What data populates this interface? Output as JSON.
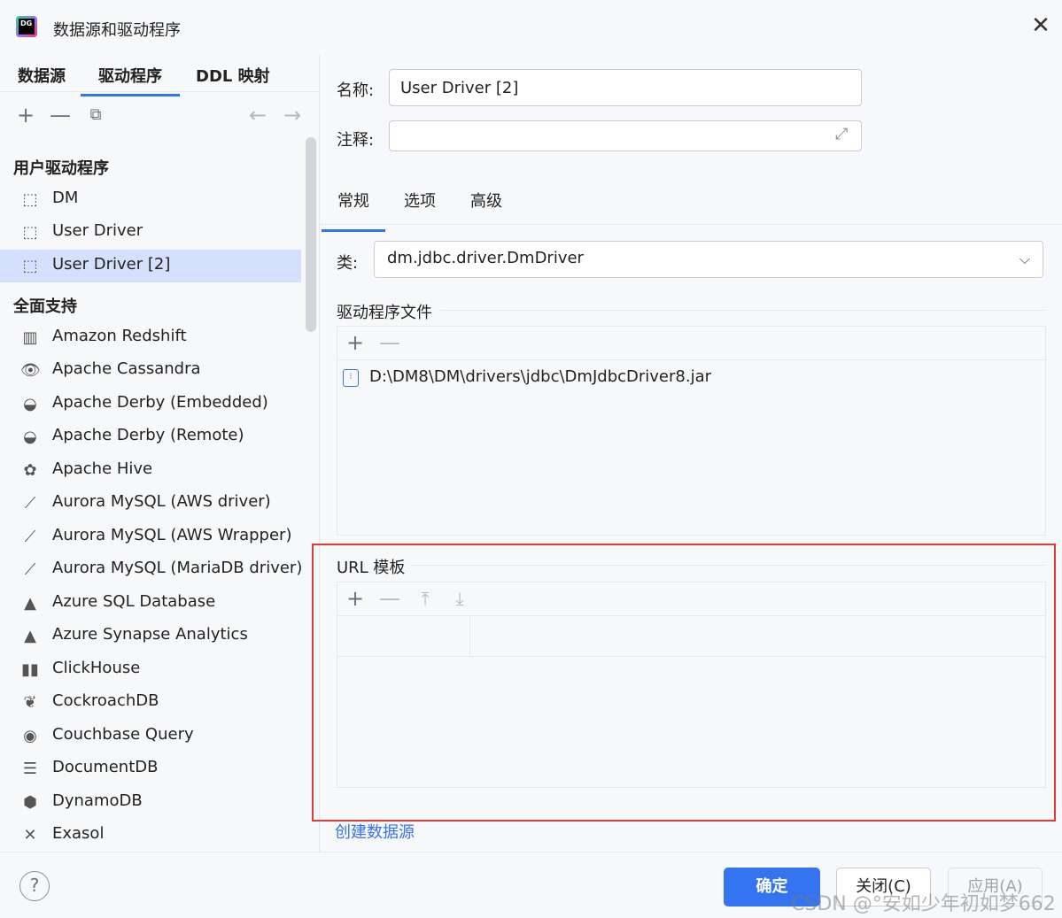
{
  "window": {
    "title": "数据源和驱动程序",
    "logo_text": "DG"
  },
  "left": {
    "tabs": [
      {
        "label": "数据源"
      },
      {
        "label": "驱动程序"
      },
      {
        "label": "DDL 映射"
      }
    ],
    "groups": [
      {
        "title": "用户驱动程序"
      },
      {
        "title": "全面支持"
      }
    ],
    "items": [
      {
        "label": "DM",
        "icon": "dashed-square-icon"
      },
      {
        "label": "User Driver",
        "icon": "dashed-square-icon"
      },
      {
        "label": "User Driver [2]",
        "icon": "dashed-square-icon"
      },
      {
        "label": "Amazon Redshift",
        "icon": "redshift-icon"
      },
      {
        "label": "Apache Cassandra",
        "icon": "cassandra-icon"
      },
      {
        "label": "Apache Derby (Embedded)",
        "icon": "derby-icon"
      },
      {
        "label": "Apache Derby (Remote)",
        "icon": "derby-icon"
      },
      {
        "label": "Apache Hive",
        "icon": "hive-icon"
      },
      {
        "label": "Aurora MySQL (AWS driver)",
        "icon": "mysql-icon"
      },
      {
        "label": "Aurora MySQL (AWS Wrapper)",
        "icon": "mysql-icon"
      },
      {
        "label": "Aurora MySQL (MariaDB driver)",
        "icon": "mysql-icon"
      },
      {
        "label": "Azure SQL Database",
        "icon": "azure-icon"
      },
      {
        "label": "Azure Synapse Analytics",
        "icon": "azure-icon"
      },
      {
        "label": "ClickHouse",
        "icon": "clickhouse-icon"
      },
      {
        "label": "CockroachDB",
        "icon": "cockroach-icon"
      },
      {
        "label": "Couchbase Query",
        "icon": "couchbase-icon"
      },
      {
        "label": "DocumentDB",
        "icon": "documentdb-icon"
      },
      {
        "label": "DynamoDB",
        "icon": "dynamodb-icon"
      },
      {
        "label": "Exasol",
        "icon": "exasol-icon"
      }
    ]
  },
  "form": {
    "name_label": "名称:",
    "name_value": "User Driver [2]",
    "comment_label": "注释:",
    "comment_value": "",
    "tabs": [
      {
        "label": "常规"
      },
      {
        "label": "选项"
      },
      {
        "label": "高级"
      }
    ],
    "class_label": "类:",
    "class_value": "dm.jdbc.driver.DmDriver",
    "driver_files_title": "驱动程序文件",
    "driver_files": [
      "D:\\DM8\\DM\\drivers\\jdbc\\DmJdbcDriver8.jar"
    ],
    "url_template_title": "URL 模板",
    "create_link": "创建数据源"
  },
  "footer": {
    "help": "?",
    "ok": "确定",
    "close": "关闭(C)",
    "apply": "应用(A)",
    "watermark": "CSDN @°安如少年初如梦662"
  },
  "colors": {
    "accent": "#3574f0",
    "selection": "#d5e1fc",
    "highlight_box": "#e03a3a"
  }
}
